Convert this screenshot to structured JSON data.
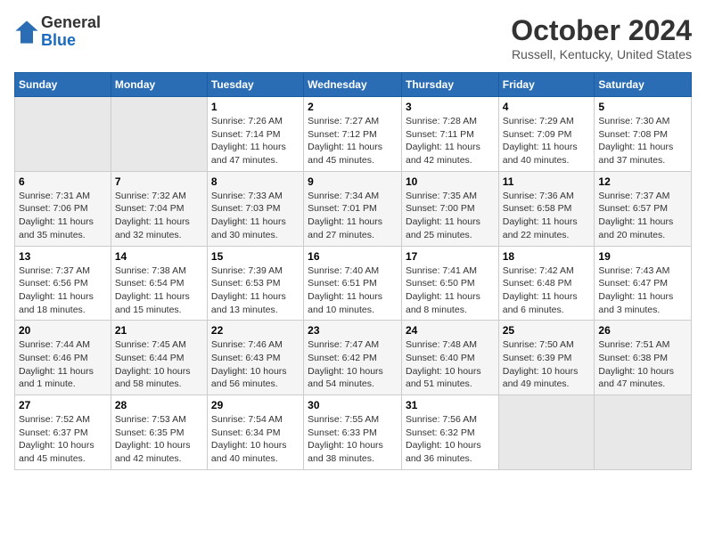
{
  "header": {
    "logo": {
      "general": "General",
      "blue": "Blue"
    },
    "title": "October 2024",
    "subtitle": "Russell, Kentucky, United States"
  },
  "calendar": {
    "days_of_week": [
      "Sunday",
      "Monday",
      "Tuesday",
      "Wednesday",
      "Thursday",
      "Friday",
      "Saturday"
    ],
    "weeks": [
      [
        {
          "day": null
        },
        {
          "day": null
        },
        {
          "day": 1,
          "sunrise": "Sunrise: 7:26 AM",
          "sunset": "Sunset: 7:14 PM",
          "daylight": "Daylight: 11 hours and 47 minutes."
        },
        {
          "day": 2,
          "sunrise": "Sunrise: 7:27 AM",
          "sunset": "Sunset: 7:12 PM",
          "daylight": "Daylight: 11 hours and 45 minutes."
        },
        {
          "day": 3,
          "sunrise": "Sunrise: 7:28 AM",
          "sunset": "Sunset: 7:11 PM",
          "daylight": "Daylight: 11 hours and 42 minutes."
        },
        {
          "day": 4,
          "sunrise": "Sunrise: 7:29 AM",
          "sunset": "Sunset: 7:09 PM",
          "daylight": "Daylight: 11 hours and 40 minutes."
        },
        {
          "day": 5,
          "sunrise": "Sunrise: 7:30 AM",
          "sunset": "Sunset: 7:08 PM",
          "daylight": "Daylight: 11 hours and 37 minutes."
        }
      ],
      [
        {
          "day": 6,
          "sunrise": "Sunrise: 7:31 AM",
          "sunset": "Sunset: 7:06 PM",
          "daylight": "Daylight: 11 hours and 35 minutes."
        },
        {
          "day": 7,
          "sunrise": "Sunrise: 7:32 AM",
          "sunset": "Sunset: 7:04 PM",
          "daylight": "Daylight: 11 hours and 32 minutes."
        },
        {
          "day": 8,
          "sunrise": "Sunrise: 7:33 AM",
          "sunset": "Sunset: 7:03 PM",
          "daylight": "Daylight: 11 hours and 30 minutes."
        },
        {
          "day": 9,
          "sunrise": "Sunrise: 7:34 AM",
          "sunset": "Sunset: 7:01 PM",
          "daylight": "Daylight: 11 hours and 27 minutes."
        },
        {
          "day": 10,
          "sunrise": "Sunrise: 7:35 AM",
          "sunset": "Sunset: 7:00 PM",
          "daylight": "Daylight: 11 hours and 25 minutes."
        },
        {
          "day": 11,
          "sunrise": "Sunrise: 7:36 AM",
          "sunset": "Sunset: 6:58 PM",
          "daylight": "Daylight: 11 hours and 22 minutes."
        },
        {
          "day": 12,
          "sunrise": "Sunrise: 7:37 AM",
          "sunset": "Sunset: 6:57 PM",
          "daylight": "Daylight: 11 hours and 20 minutes."
        }
      ],
      [
        {
          "day": 13,
          "sunrise": "Sunrise: 7:37 AM",
          "sunset": "Sunset: 6:56 PM",
          "daylight": "Daylight: 11 hours and 18 minutes."
        },
        {
          "day": 14,
          "sunrise": "Sunrise: 7:38 AM",
          "sunset": "Sunset: 6:54 PM",
          "daylight": "Daylight: 11 hours and 15 minutes."
        },
        {
          "day": 15,
          "sunrise": "Sunrise: 7:39 AM",
          "sunset": "Sunset: 6:53 PM",
          "daylight": "Daylight: 11 hours and 13 minutes."
        },
        {
          "day": 16,
          "sunrise": "Sunrise: 7:40 AM",
          "sunset": "Sunset: 6:51 PM",
          "daylight": "Daylight: 11 hours and 10 minutes."
        },
        {
          "day": 17,
          "sunrise": "Sunrise: 7:41 AM",
          "sunset": "Sunset: 6:50 PM",
          "daylight": "Daylight: 11 hours and 8 minutes."
        },
        {
          "day": 18,
          "sunrise": "Sunrise: 7:42 AM",
          "sunset": "Sunset: 6:48 PM",
          "daylight": "Daylight: 11 hours and 6 minutes."
        },
        {
          "day": 19,
          "sunrise": "Sunrise: 7:43 AM",
          "sunset": "Sunset: 6:47 PM",
          "daylight": "Daylight: 11 hours and 3 minutes."
        }
      ],
      [
        {
          "day": 20,
          "sunrise": "Sunrise: 7:44 AM",
          "sunset": "Sunset: 6:46 PM",
          "daylight": "Daylight: 11 hours and 1 minute."
        },
        {
          "day": 21,
          "sunrise": "Sunrise: 7:45 AM",
          "sunset": "Sunset: 6:44 PM",
          "daylight": "Daylight: 10 hours and 58 minutes."
        },
        {
          "day": 22,
          "sunrise": "Sunrise: 7:46 AM",
          "sunset": "Sunset: 6:43 PM",
          "daylight": "Daylight: 10 hours and 56 minutes."
        },
        {
          "day": 23,
          "sunrise": "Sunrise: 7:47 AM",
          "sunset": "Sunset: 6:42 PM",
          "daylight": "Daylight: 10 hours and 54 minutes."
        },
        {
          "day": 24,
          "sunrise": "Sunrise: 7:48 AM",
          "sunset": "Sunset: 6:40 PM",
          "daylight": "Daylight: 10 hours and 51 minutes."
        },
        {
          "day": 25,
          "sunrise": "Sunrise: 7:50 AM",
          "sunset": "Sunset: 6:39 PM",
          "daylight": "Daylight: 10 hours and 49 minutes."
        },
        {
          "day": 26,
          "sunrise": "Sunrise: 7:51 AM",
          "sunset": "Sunset: 6:38 PM",
          "daylight": "Daylight: 10 hours and 47 minutes."
        }
      ],
      [
        {
          "day": 27,
          "sunrise": "Sunrise: 7:52 AM",
          "sunset": "Sunset: 6:37 PM",
          "daylight": "Daylight: 10 hours and 45 minutes."
        },
        {
          "day": 28,
          "sunrise": "Sunrise: 7:53 AM",
          "sunset": "Sunset: 6:35 PM",
          "daylight": "Daylight: 10 hours and 42 minutes."
        },
        {
          "day": 29,
          "sunrise": "Sunrise: 7:54 AM",
          "sunset": "Sunset: 6:34 PM",
          "daylight": "Daylight: 10 hours and 40 minutes."
        },
        {
          "day": 30,
          "sunrise": "Sunrise: 7:55 AM",
          "sunset": "Sunset: 6:33 PM",
          "daylight": "Daylight: 10 hours and 38 minutes."
        },
        {
          "day": 31,
          "sunrise": "Sunrise: 7:56 AM",
          "sunset": "Sunset: 6:32 PM",
          "daylight": "Daylight: 10 hours and 36 minutes."
        },
        {
          "day": null
        },
        {
          "day": null
        }
      ]
    ]
  }
}
